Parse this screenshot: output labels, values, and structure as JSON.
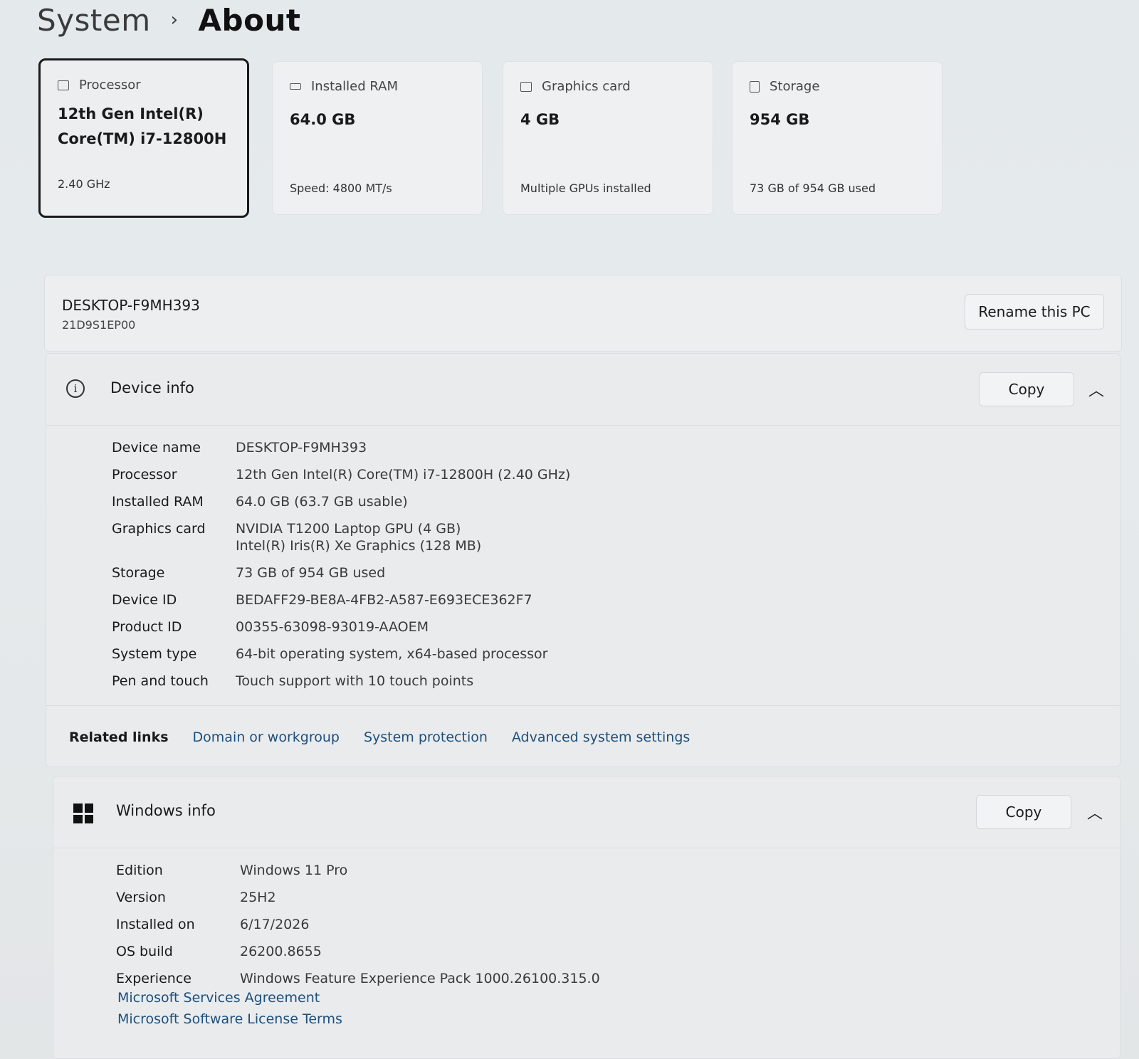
{
  "breadcrumb": {
    "parent": "System",
    "separator": "›",
    "current": "About"
  },
  "summary_cards": [
    {
      "label": "Processor",
      "value": "12th Gen Intel(R) Core(TM) i7-12800H",
      "sub": "2.40 GHz",
      "icon": "processor-icon"
    },
    {
      "label": "Installed RAM",
      "value": "64.0 GB",
      "sub": "Speed: 4800 MT/s",
      "icon": "ram-icon"
    },
    {
      "label": "Graphics card",
      "value": "4 GB",
      "sub": "Multiple GPUs installed",
      "icon": "graphics-card-icon"
    },
    {
      "label": "Storage",
      "value": "954 GB",
      "sub": "73 GB of 954 GB used",
      "icon": "storage-icon"
    }
  ],
  "pc": {
    "name": "DESKTOP-F9MH393",
    "model": "21D9S1EP00",
    "rename_label": "Rename this PC"
  },
  "device_info": {
    "title": "Device info",
    "copy_label": "Copy",
    "rows": [
      {
        "key": "Device name",
        "value": "DESKTOP-F9MH393"
      },
      {
        "key": "Processor",
        "value": "12th Gen Intel(R) Core(TM) i7-12800H (2.40 GHz)"
      },
      {
        "key": "Installed RAM",
        "value": "64.0 GB (63.7 GB usable)"
      },
      {
        "key": "Graphics card",
        "value": "NVIDIA T1200 Laptop GPU (4 GB)",
        "value2": "Intel(R) Iris(R) Xe Graphics (128 MB)"
      },
      {
        "key": "Storage",
        "value": "73 GB of 954 GB used"
      },
      {
        "key": "Device ID",
        "value": "BEDAFF29-BE8A-4FB2-A587-E693ECE362F7"
      },
      {
        "key": "Product ID",
        "value": "00355-63098-93019-AAOEM"
      },
      {
        "key": "System type",
        "value": "64-bit operating system, x64-based processor"
      },
      {
        "key": "Pen and touch",
        "value": "Touch support with 10 touch points"
      }
    ]
  },
  "related_links": {
    "label": "Related links",
    "links": [
      "Domain or workgroup",
      "System protection",
      "Advanced system settings"
    ]
  },
  "windows_info": {
    "title": "Windows info",
    "copy_label": "Copy",
    "rows": [
      {
        "key": "Edition",
        "value": "Windows 11 Pro"
      },
      {
        "key": "Version",
        "value": "25H2"
      },
      {
        "key": "Installed on",
        "value": "6/17/2026"
      },
      {
        "key": "OS build",
        "value": "26200.8655"
      },
      {
        "key": "Experience",
        "value": "Windows Feature Experience Pack 1000.26100.315.0"
      }
    ],
    "links": [
      "Microsoft Services Agreement",
      "Microsoft Software License Terms"
    ]
  }
}
